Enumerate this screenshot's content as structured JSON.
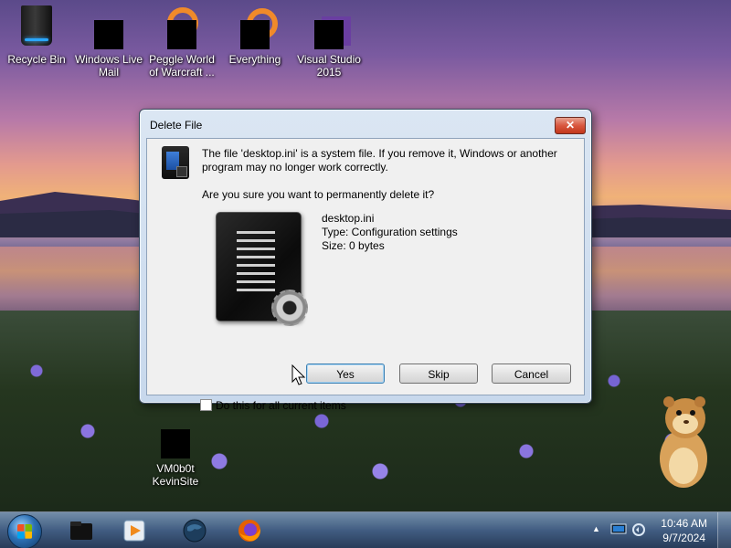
{
  "desktop": {
    "icons": [
      {
        "label": "Recycle Bin",
        "icon": "recycle-bin-icon"
      },
      {
        "label": "Windows Live Mail",
        "icon": "windows-live-mail-icon"
      },
      {
        "label": "Peggle World of Warcraft ...",
        "icon": "peggle-icon"
      },
      {
        "label": "Everything",
        "icon": "everything-icon"
      },
      {
        "label": "Visual Studio 2015",
        "icon": "visual-studio-icon"
      },
      {
        "label": "VM0b0t KevinSite",
        "icon": "shortcut-icon"
      }
    ]
  },
  "dialog": {
    "title": "Delete File",
    "close_label": "✕",
    "message_line1": "The file 'desktop.ini' is a system file. If you remove it, Windows or another",
    "message_line2": "program may no longer work correctly.",
    "question": "Are you sure you want to permanently delete it?",
    "file": {
      "name": "desktop.ini",
      "type": "Type: Configuration settings",
      "size": "Size: 0 bytes"
    },
    "buttons": {
      "yes": "Yes",
      "skip": "Skip",
      "cancel": "Cancel"
    },
    "checkbox_label": "Do this for all current items",
    "checkbox_checked": false
  },
  "taskbar": {
    "pinned": [
      "file-manager-icon",
      "media-player-icon",
      "globe-icon",
      "firefox-icon"
    ],
    "tray_icons": [
      "show-hidden-icons-icon",
      "network-icon",
      "volume-icon"
    ],
    "tray_expand": "▲",
    "time": "10:46 AM",
    "date": "9/7/2024"
  },
  "colors": {
    "dialog_frame": "#c7d8ec",
    "dialog_client": "#f0f0f0",
    "close_button": "#d9573f",
    "default_button_border": "#3c7fb1",
    "taskbar": "#46648c"
  }
}
